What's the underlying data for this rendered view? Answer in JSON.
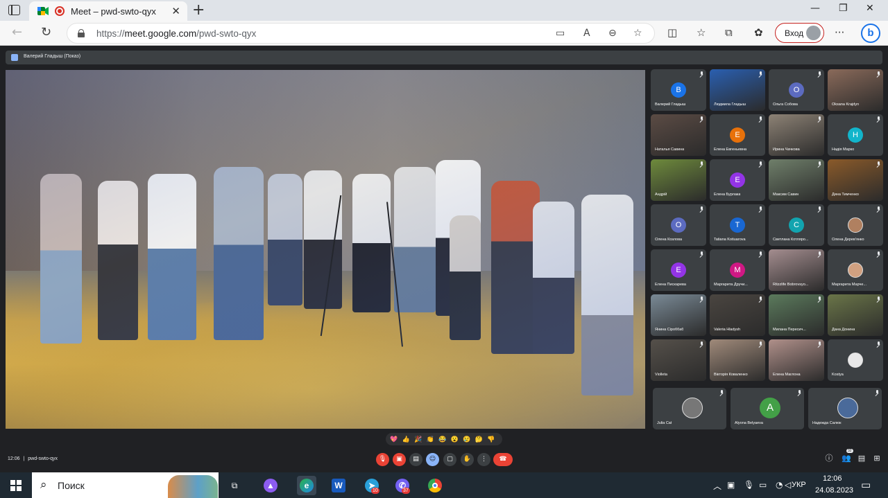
{
  "browser": {
    "tab_title": "Meet – pwd-swto-qyx",
    "url_scheme": "https://",
    "url_host": "meet.google.com",
    "url_path": "/pwd-swto-qyx",
    "login_label": "Вход"
  },
  "meet": {
    "presenter_label": "Валерий Гладыш (Показ)",
    "meeting_time": "12:06",
    "meeting_code": "pwd-swto-qyx",
    "participants_count": "32",
    "participants": [
      {
        "name": "Валерий Гладыш",
        "initial": "В",
        "color": "#1a73e8",
        "type": "avatar"
      },
      {
        "name": "Людмила Гладыш",
        "initial": "",
        "color": "#2a5fb0",
        "type": "video"
      },
      {
        "name": "Ольга Собова",
        "initial": "О",
        "color": "#5c6bc0",
        "type": "avatar"
      },
      {
        "name": "Oksana Krajdyn",
        "initial": "",
        "color": "#8a6a5a",
        "type": "video"
      },
      {
        "name": "Наталья Савина",
        "initial": "",
        "color": "#5b4b44",
        "type": "video"
      },
      {
        "name": "Елена Евгеньевна",
        "initial": "Е",
        "color": "#e8710a",
        "type": "avatar"
      },
      {
        "name": "Ирина Чачкова",
        "initial": "",
        "color": "#8d8275",
        "type": "video"
      },
      {
        "name": "Надія Марко",
        "initial": "Н",
        "color": "#12b5cb",
        "type": "avatar"
      },
      {
        "name": "Андрій",
        "initial": "",
        "color": "#6e8a3c",
        "type": "video"
      },
      {
        "name": "Елена Бурлака",
        "initial": "Е",
        "color": "#9334e6",
        "type": "avatar"
      },
      {
        "name": "Максим Савин",
        "initial": "",
        "color": "#6f7f6a",
        "type": "video"
      },
      {
        "name": "Дина Тимченко",
        "initial": "",
        "color": "#8a5a2a",
        "type": "video"
      },
      {
        "name": "Олена Козлова",
        "initial": "О",
        "color": "#5c6bc0",
        "type": "avatar"
      },
      {
        "name": "Tatiana Kotiuarova",
        "initial": "Т",
        "color": "#1967d2",
        "type": "avatar"
      },
      {
        "name": "Светлана Котлярo...",
        "initial": "С",
        "color": "#12a4af",
        "type": "avatar"
      },
      {
        "name": "Олена Дерев'янко",
        "initial": "",
        "color": "#b08060",
        "type": "photo"
      },
      {
        "name": "Елена Пискарева",
        "initial": "Е",
        "color": "#9334e6",
        "type": "avatar"
      },
      {
        "name": "Маргарита Дручи...",
        "initial": "М",
        "color": "#d01884",
        "type": "avatar"
      },
      {
        "name": "Ritzzlife Bobrovsyo...",
        "initial": "",
        "color": "#a48d8f",
        "type": "video"
      },
      {
        "name": "Маргарита Марче...",
        "initial": "",
        "color": "#d0a080",
        "type": "photo"
      },
      {
        "name": "Янина Сіроббаб",
        "initial": "",
        "color": "#7a8a96",
        "type": "video"
      },
      {
        "name": "Valeria Hladysh",
        "initial": "",
        "color": "#4a4540",
        "type": "video"
      },
      {
        "name": "Милана Пересич...",
        "initial": "",
        "color": "#5b7a5c",
        "type": "video"
      },
      {
        "name": "Дана Донина",
        "initial": "",
        "color": "#6a7548",
        "type": "video"
      },
      {
        "name": "Violleta",
        "initial": "",
        "color": "#55504a",
        "type": "video"
      },
      {
        "name": "Вікторія Коваленко",
        "initial": "",
        "color": "#a08a7a",
        "type": "video"
      },
      {
        "name": "Елена Маглона",
        "initial": "",
        "color": "#b0908a",
        "type": "video"
      },
      {
        "name": "Kostya",
        "initial": "",
        "color": "#e8e8e8",
        "type": "photo"
      },
      {
        "name": "Julia Cat",
        "initial": "",
        "color": "#777",
        "type": "photo"
      },
      {
        "name": "Alyona Belyaeva",
        "initial": "A",
        "color": "#43a047",
        "type": "avatar"
      },
      {
        "name": "Надежда Салюк",
        "initial": "",
        "color": "#4a6a9a",
        "type": "photo"
      }
    ],
    "reactions": [
      "💖",
      "👍",
      "🎉",
      "👏",
      "😂",
      "😮",
      "😢",
      "🤔",
      "👎"
    ]
  },
  "taskbar": {
    "search_text": "Поиск",
    "telegram_badge": "10",
    "viber_badge": "37",
    "language": "УКР",
    "time": "12:06",
    "date": "24.08.2023"
  }
}
